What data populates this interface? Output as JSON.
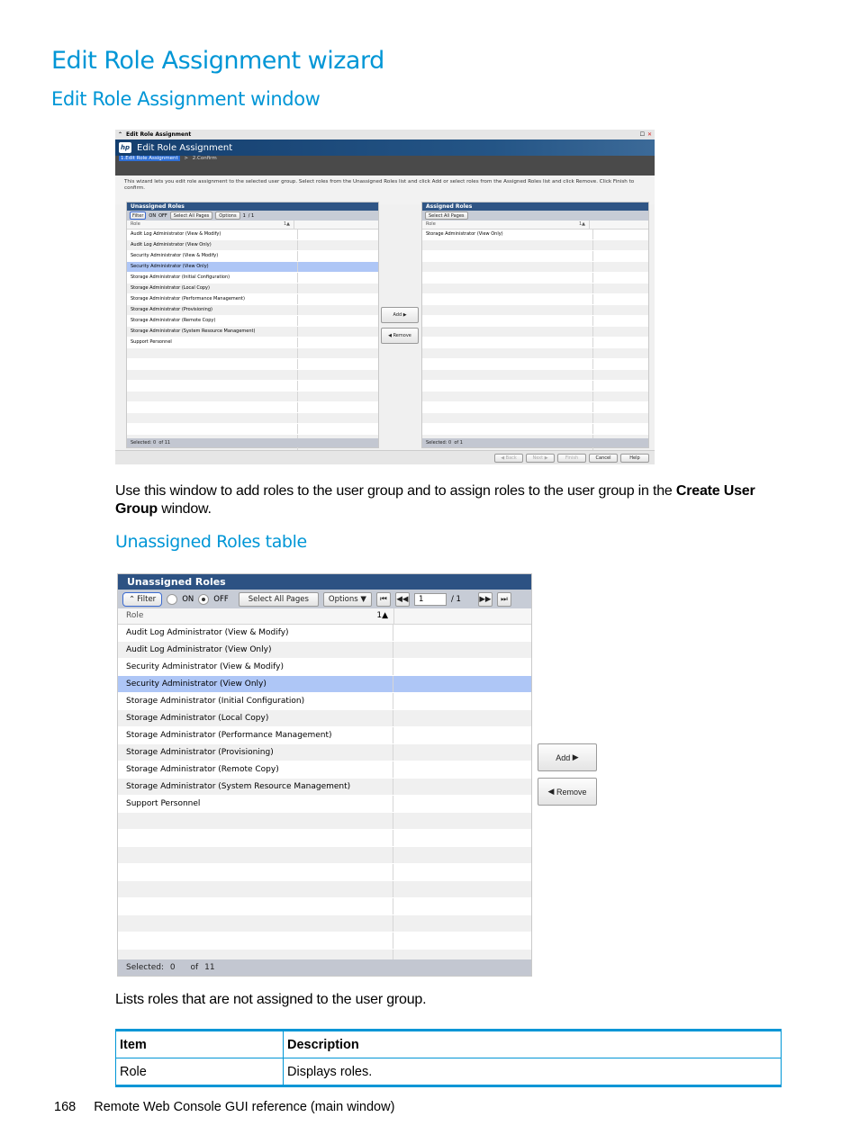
{
  "doc": {
    "title": "Edit Role Assignment wizard",
    "section_title": "Edit Role Assignment window",
    "intro_text_1": "Use this window to add roles to the user group and to assign roles to the user group in the ",
    "intro_bold_1": "Create User Group",
    "intro_text_2": " window.",
    "subsection_title": "Unassigned Roles table",
    "subsection_desc": "Lists roles that are not assigned to the user group.",
    "footer_page": "168",
    "footer_text": "Remote Web Console GUI reference (main window)"
  },
  "window": {
    "titlebar": "Edit Role Assignment",
    "banner_title": "Edit Role Assignment",
    "logo": "hp",
    "steps": [
      "1.Edit Role Assignment",
      "2.Confirm"
    ],
    "step_separator": ">",
    "description": "This wizard lets you edit role assignment to the selected user group. Select roles from the Unassigned Roles list and click Add or select roles from the Assigned Roles list and click Remove. Click Finish to confirm.",
    "buttons": {
      "back": "◀ Back",
      "next": "Next ▶",
      "finish": "Finish",
      "cancel": "Cancel",
      "help": "Help"
    },
    "assigned_roles": {
      "title": "Assigned Roles",
      "select_all": "Select All Pages",
      "column": "Role",
      "sort": "1▲",
      "rows": [
        "Storage Administrator (View Only)"
      ],
      "selected_label": "Selected:",
      "selected_count": "0",
      "of_label": "of",
      "total": "1"
    }
  },
  "unassigned_roles": {
    "title": "Unassigned Roles",
    "filter": "Filter",
    "on": "ON",
    "off": "OFF",
    "filter_state": "OFF",
    "select_all": "Select All Pages",
    "options": "Options",
    "page": "1",
    "page_total": "/ 1",
    "column": "Role",
    "sort": "1▲",
    "rows": [
      "Audit Log Administrator (View & Modify)",
      "Audit Log Administrator (View Only)",
      "Security Administrator (View & Modify)",
      "Security Administrator (View Only)",
      "Storage Administrator (Initial Configuration)",
      "Storage Administrator (Local Copy)",
      "Storage Administrator (Performance Management)",
      "Storage Administrator (Provisioning)",
      "Storage Administrator (Remote Copy)",
      "Storage Administrator (System Resource Management)",
      "Support Personnel"
    ],
    "selected_row_index": 3,
    "selected_label": "Selected:",
    "selected_count": "0",
    "of_label": "of",
    "total": "11",
    "add_button": "Add",
    "remove_button": "Remove"
  },
  "item_table": {
    "headers": [
      "Item",
      "Description"
    ],
    "rows": [
      [
        "Role",
        "Displays roles."
      ]
    ]
  },
  "colors": {
    "heading": "#0096d6",
    "panel_header": "#2f5585",
    "selected_row": "#aec6f6"
  }
}
